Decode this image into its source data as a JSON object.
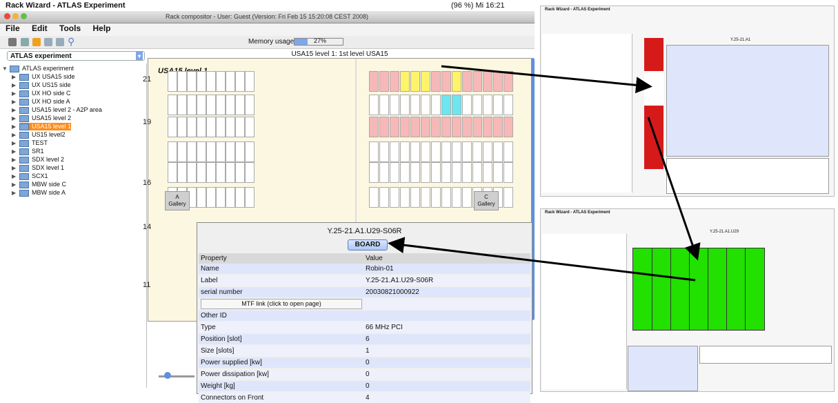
{
  "mac_menubar": {
    "app": "Rack Wizard - ATLAS Experiment",
    "status": "(96 %)  Mi 16:21"
  },
  "window": {
    "title": "Rack compositor - User: Guest (Version: Fri Feb 15 15:20:08 CEST 2008)"
  },
  "menu": {
    "file": "File",
    "edit": "Edit",
    "tools": "Tools",
    "help": "Help"
  },
  "memory": {
    "label": "Memory usage:",
    "value": "27%",
    "fraction": 0.27
  },
  "selector": {
    "value": "ATLAS experiment"
  },
  "tree": [
    {
      "label": "ATLAS experiment",
      "expanded": true,
      "root": true
    },
    {
      "label": "UX USA15 side"
    },
    {
      "label": "UX US15 side"
    },
    {
      "label": "UX HO side C"
    },
    {
      "label": "UX HO side A"
    },
    {
      "label": "USA15 level 2 - A2P area"
    },
    {
      "label": "USA15 level 2"
    },
    {
      "label": "USA15 level 1",
      "selected": true
    },
    {
      "label": "US15 level2"
    },
    {
      "label": "TEST"
    },
    {
      "label": "SR1"
    },
    {
      "label": "SDX level 2"
    },
    {
      "label": "SDX level 1"
    },
    {
      "label": "SCX1"
    },
    {
      "label": "MBW side C"
    },
    {
      "label": "MBW side A"
    }
  ],
  "viewer": {
    "title": "USA15 level 1: 1st level USA15",
    "header": "USA15 level 1",
    "rows": [
      "21",
      "19",
      "16",
      "14",
      "11"
    ],
    "gallery_a": {
      "letter": "A",
      "label": "Gallery"
    },
    "gallery_c": {
      "letter": "C",
      "label": "Gallery"
    }
  },
  "panel": {
    "title": "Y.25-21.A1.U29-S06R",
    "board_button": "BOARD",
    "header": {
      "key": "Property",
      "value": "Value"
    },
    "mtf_link": "MTF link (click to open page)",
    "rows": [
      {
        "key": "Name",
        "value": "Robin-01"
      },
      {
        "key": "Label",
        "value": "Y.25-21.A1.U29-S06R"
      },
      {
        "key": "serial number",
        "value": "20030821000922"
      },
      {
        "key": "Other ID",
        "value": ""
      },
      {
        "key": "Type",
        "value": "66 MHz PCI"
      },
      {
        "key": "Position [slot]",
        "value": "6"
      },
      {
        "key": "Size [slots]",
        "value": "1"
      },
      {
        "key": "Power supplied [kw]",
        "value": "0"
      },
      {
        "key": "Power dissipation [kw]",
        "value": "0"
      },
      {
        "key": "Weight [kg]",
        "value": "0"
      },
      {
        "key": "Connectors on Front",
        "value": "4"
      }
    ]
  },
  "thumb_top": {
    "app": "Rack Wizard - ATLAS Experiment",
    "label": "Y.25-21.A1"
  },
  "thumb_bottom": {
    "app": "Rack Wizard - ATLAS Experiment",
    "label": "Y.25-21.A1.U29"
  },
  "colors": {
    "selection": "#ff8c1a",
    "rack_red": "#d61a1a",
    "board_green": "#22e000",
    "panel_blue": "#dfe6fb"
  }
}
